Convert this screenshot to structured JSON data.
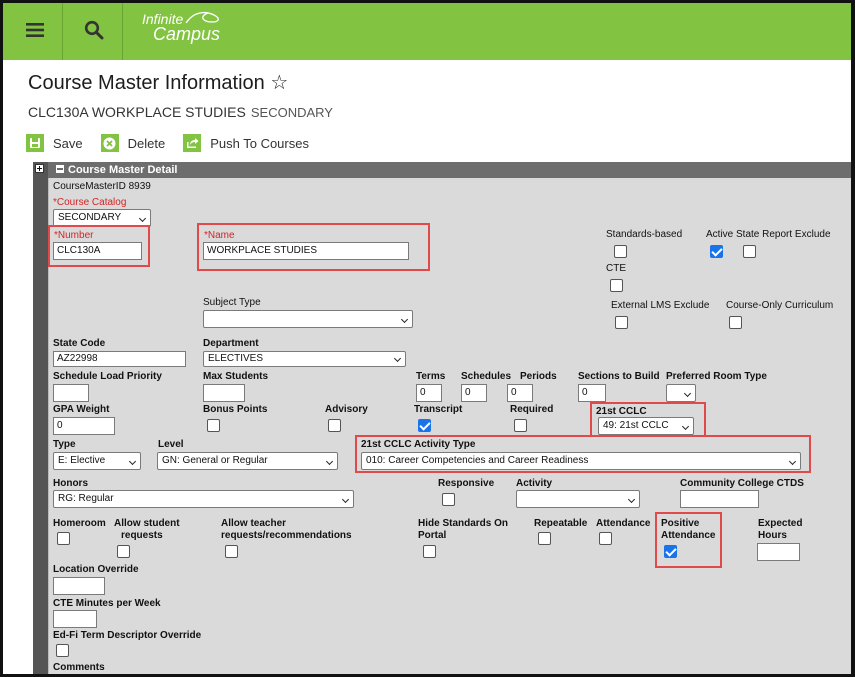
{
  "app": {
    "logo_line1": "Infinite",
    "logo_line2": "Campus"
  },
  "header": {
    "title": "Course Master Information ☆",
    "course_name": "CLC130A WORKPLACE STUDIES",
    "course_type": "SECONDARY"
  },
  "toolbar": {
    "save": "Save",
    "delete": "Delete",
    "push": "Push To Courses"
  },
  "panel": {
    "title": "Course Master Detail"
  },
  "fields": {
    "course_master_id": "CourseMasterID 8939",
    "course_catalog_label": "*Course Catalog",
    "course_catalog_value": "SECONDARY",
    "number_label": "*Number",
    "number_value": "CLC130A",
    "name_label": "*Name",
    "name_value": "WORKPLACE STUDIES",
    "standards_based": "Standards-based",
    "active_state_report_exclude": "Active State Report Exclude",
    "cte": "CTE",
    "subject_type": "Subject Type",
    "external_lms_exclude": "External LMS Exclude",
    "course_only_curriculum": "Course-Only Curriculum",
    "state_code_label": "State Code",
    "state_code_value": "AZ22998",
    "department_label": "Department",
    "department_value": "ELECTIVES",
    "schedule_load_priority": "Schedule Load Priority",
    "max_students": "Max Students",
    "terms_label": "Terms",
    "terms_value": "0",
    "schedules_label": "Schedules",
    "schedules_value": "0",
    "periods_label": "Periods",
    "periods_value": "0",
    "sections_to_build_label": "Sections to Build",
    "sections_to_build_value": "0",
    "preferred_room_type": "Preferred Room Type",
    "gpa_weight_label": "GPA Weight",
    "gpa_weight_value": "0",
    "bonus_points": "Bonus Points",
    "advisory": "Advisory",
    "transcript": "Transcript",
    "required": "Required",
    "cclc_label": "21st CCLC",
    "cclc_value": "49: 21st CCLC",
    "type_label": "Type",
    "type_value": "E: Elective",
    "level_label": "Level",
    "level_value": "GN: General or Regular",
    "cclc_activity_label": "21st CCLC Activity Type",
    "cclc_activity_value": "010: Career Competencies and Career Readiness",
    "honors_label": "Honors",
    "honors_value": "RG: Regular",
    "responsive": "Responsive",
    "activity": "Activity",
    "community_college_ctds": "Community College CTDS",
    "homeroom": "Homeroom",
    "allow_student_requests_1": "Allow student",
    "allow_student_requests_2": "requests",
    "allow_teacher_requests_1": "Allow teacher",
    "allow_teacher_requests_2": "requests/recommendations",
    "hide_standards_1": "Hide Standards On",
    "hide_standards_2": "Portal",
    "repeatable": "Repeatable",
    "attendance": "Attendance",
    "positive_attendance_1": "Positive",
    "positive_attendance_2": "Attendance",
    "expected_hours_1": "Expected",
    "expected_hours_2": "Hours",
    "location_override": "Location Override",
    "cte_minutes_per_week": "CTE Minutes per Week",
    "edfi_term_descriptor_override": "Ed-Fi Term Descriptor Override",
    "comments": "Comments"
  },
  "checkboxes": {
    "standards_based": false,
    "active_state_report_exclude": true,
    "active_state_report_exclude_2": false,
    "cte": false,
    "external_lms_exclude": false,
    "course_only_curriculum": false,
    "bonus_points": false,
    "advisory": false,
    "transcript": true,
    "required": false,
    "responsive": false,
    "homeroom": false,
    "allow_student_requests": false,
    "allow_teacher_requests": false,
    "hide_standards_on_portal": false,
    "repeatable": false,
    "attendance": false,
    "positive_attendance": true,
    "edfi_term_descriptor_override": false
  },
  "colors": {
    "brand_green": "#82c341",
    "highlight_red": "#e04a4a",
    "check_blue": "#1a73e8"
  }
}
